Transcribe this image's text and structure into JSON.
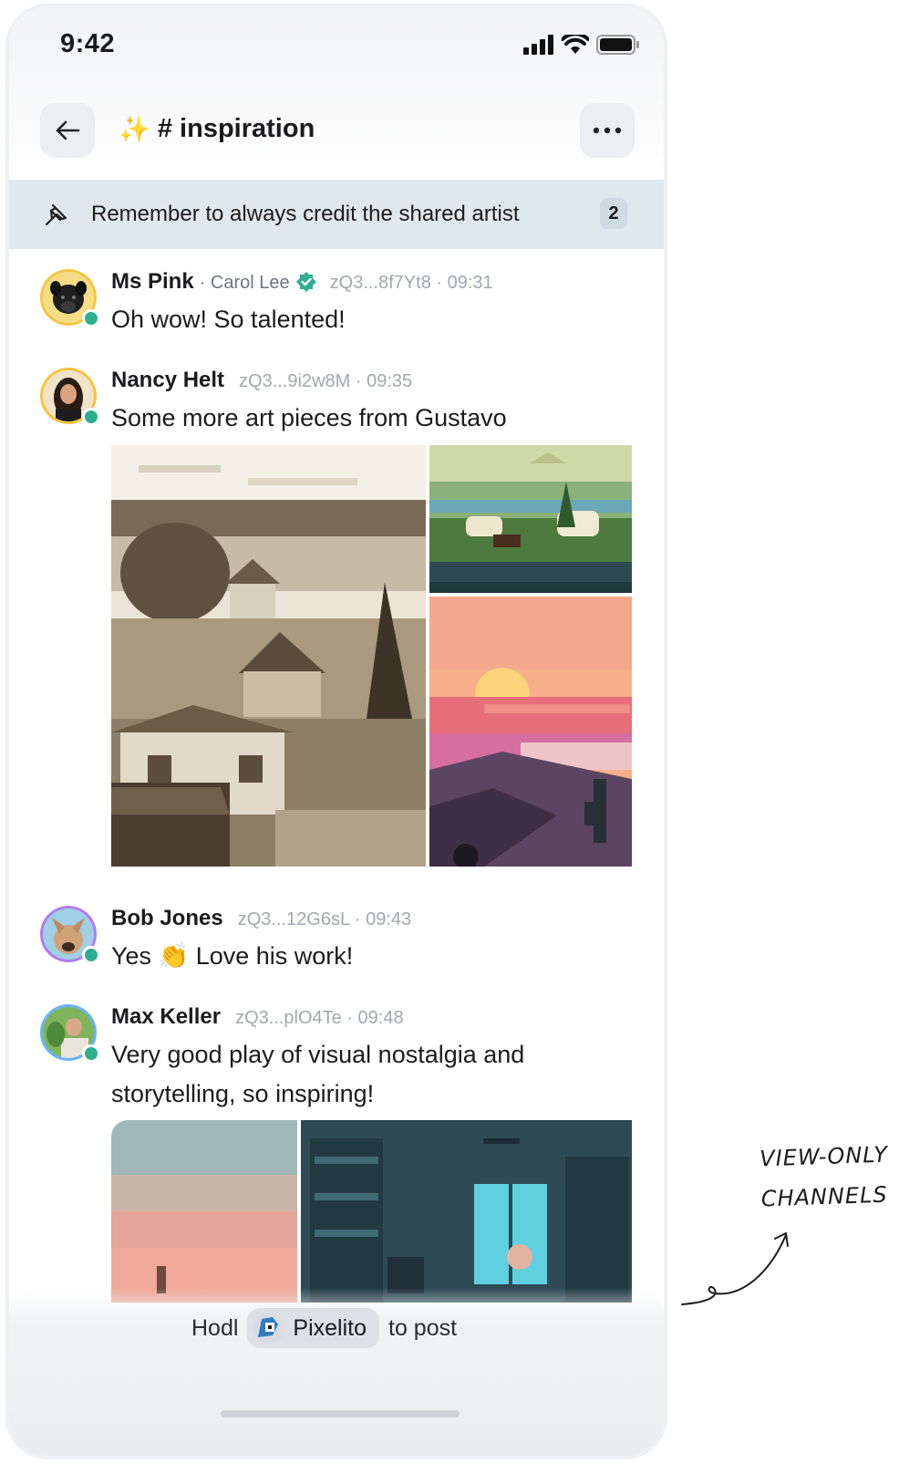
{
  "status_bar": {
    "time": "9:42"
  },
  "header": {
    "channel_emoji": "✨",
    "channel_name": "# inspiration"
  },
  "pinned": {
    "text": "Remember to always credit the shared artist",
    "count": "2"
  },
  "messages": [
    {
      "author": "Ms Pink",
      "alias": "· Carol Lee",
      "verified": true,
      "meta": "zQ3...8f7Yt8 · 09:31",
      "text": "Oh wow! So talented!",
      "avatar_color": "#f3c640"
    },
    {
      "author": "Nancy Helt",
      "meta": "zQ3...9i2w8M · 09:35",
      "text": "Some more art pieces from Gustavo",
      "avatar_color": "#f3c640"
    },
    {
      "author": "Bob Jones",
      "meta": "zQ3...12G6sL · 09:43",
      "text_before": "Yes",
      "emoji": "👏",
      "text_after": "Love his work!",
      "avatar_color": "#b07cf0"
    },
    {
      "author": "Max Keller",
      "meta": "zQ3...plO4Te · 09:48",
      "text": "Very good play of visual nostalgia and storytelling, so inspiring!",
      "avatar_color": "#6ab0ff"
    }
  ],
  "post_bar": {
    "prefix": "Hodl",
    "community": "Pixelito",
    "suffix": "to post"
  },
  "annotation": {
    "line1": "VIEW-ONLY",
    "line2": "CHANNELS"
  },
  "colors": {
    "online": "#2fae8f",
    "verified": "#2fae8f",
    "pinned_bg": "#dfe8ed"
  }
}
